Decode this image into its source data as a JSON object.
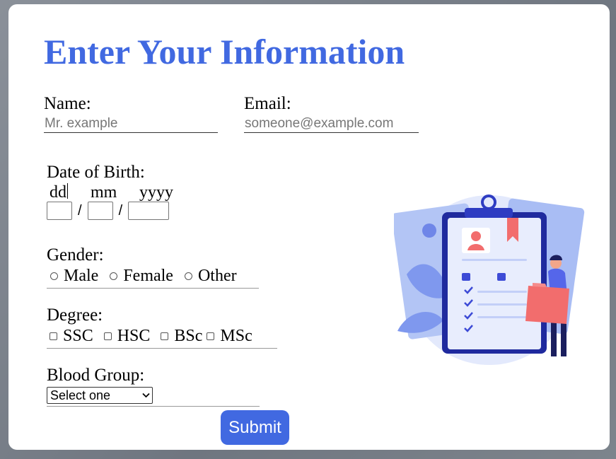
{
  "form": {
    "title": "Enter Your Information",
    "name": {
      "label": "Name:",
      "placeholder": "Mr. example",
      "value": ""
    },
    "email": {
      "label": "Email:",
      "placeholder": "someone@example.com",
      "value": ""
    },
    "dob": {
      "label": "Date of Birth:",
      "hints": [
        "dd",
        "mm",
        "yyyy"
      ],
      "separator": "/"
    },
    "gender": {
      "label": "Gender:",
      "options": [
        "Male",
        "Female",
        "Other"
      ]
    },
    "degree": {
      "label": "Degree:",
      "options": [
        "SSC",
        "HSC",
        "BSc",
        "MSc"
      ]
    },
    "blood_group": {
      "label": "Blood Group:",
      "selected": "Select one"
    },
    "submit_label": "Submit"
  },
  "illustration": {
    "icon": "clipboard-person-illustration-icon"
  },
  "colors": {
    "accent": "#4169e1",
    "illustration_blue": "#3d4bd6",
    "illustration_coral": "#f26d6d",
    "illustration_light": "#dfe6fb"
  }
}
